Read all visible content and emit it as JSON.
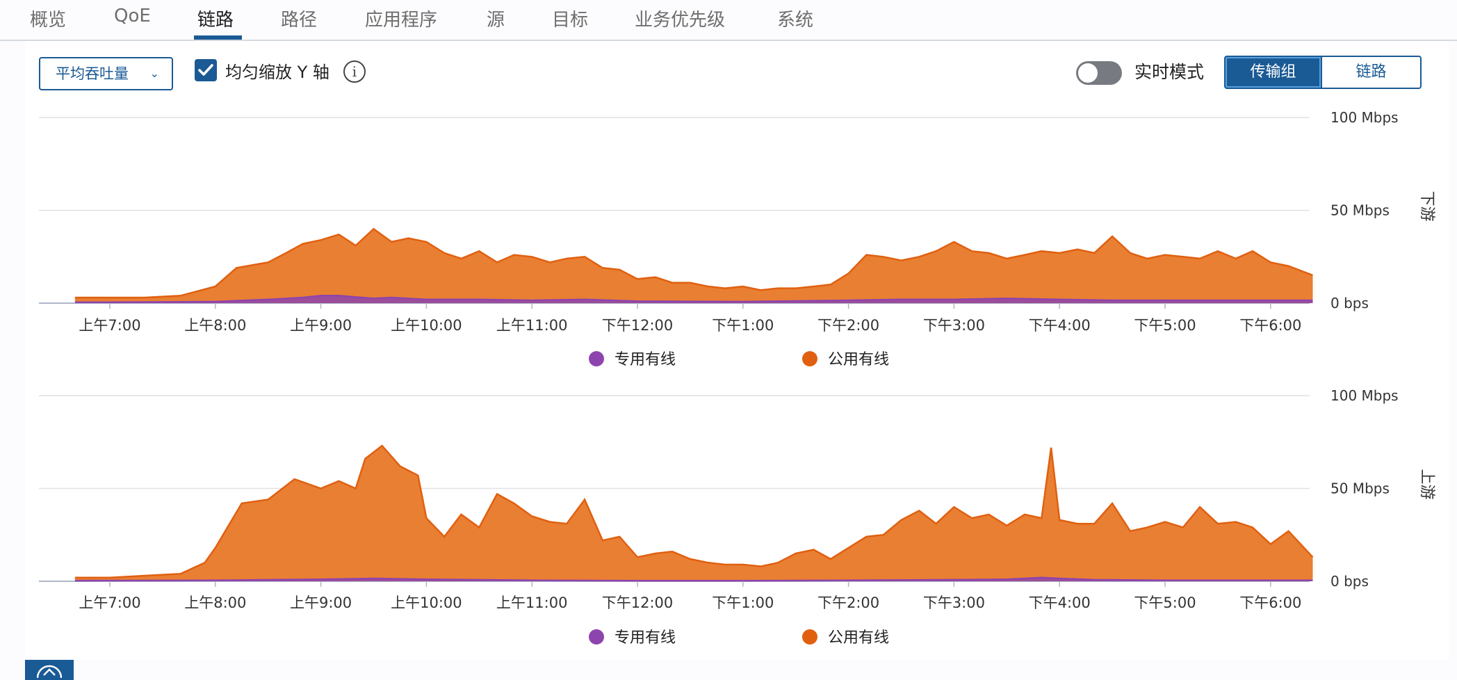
{
  "tabs": [
    {
      "label": "概览",
      "left": 43
    },
    {
      "label": "QoE",
      "left": 164
    },
    {
      "label": "链路",
      "left": 284,
      "active": true
    },
    {
      "label": "路径",
      "left": 404
    },
    {
      "label": "应用程序",
      "left": 525
    },
    {
      "label": "源",
      "left": 700
    },
    {
      "label": "目标",
      "left": 794
    },
    {
      "label": "业务优先级",
      "left": 913
    },
    {
      "label": "系统",
      "left": 1118
    }
  ],
  "toolbar": {
    "metric_dropdown": "平均吞吐量",
    "scale_y_checkbox_label": "均匀缩放 Y 轴",
    "scale_y_checked": true,
    "info_icon": "info-icon",
    "realtime_label": "实时模式",
    "realtime_on": false,
    "group_transport": "传输组",
    "group_link": "链路"
  },
  "colors": {
    "private": "#8e44ad",
    "public": "#e06010",
    "public_fill": "#e97f33",
    "accent": "#1a5a95"
  },
  "chart_data": [
    {
      "type": "area",
      "side_label": "下游",
      "ylim": [
        0,
        100
      ],
      "y_ticks": [
        "0 bps",
        "50 Mbps",
        "100 Mbps"
      ],
      "x_tick_labels": [
        "上午7:00",
        "上午8:00",
        "上午9:00",
        "上午10:00",
        "上午11:00",
        "下午12:00",
        "下午1:00",
        "下午2:00",
        "下午3:00",
        "下午4:00",
        "下午5:00",
        "下午6:00"
      ],
      "series": [
        {
          "name": "专用有线",
          "color": "#8e44ad",
          "points": [
            [
              6.67,
              0.5
            ],
            [
              7.0,
              0.5
            ],
            [
              7.5,
              0.6
            ],
            [
              8.0,
              0.8
            ],
            [
              8.5,
              2.0
            ],
            [
              8.83,
              3.0
            ],
            [
              9.0,
              4.0
            ],
            [
              9.17,
              4.0
            ],
            [
              9.5,
              2.5
            ],
            [
              9.67,
              3.0
            ],
            [
              10.0,
              2.0
            ],
            [
              10.5,
              2.0
            ],
            [
              11.0,
              1.5
            ],
            [
              11.5,
              2.0
            ],
            [
              12.0,
              1.0
            ],
            [
              13.0,
              0.8
            ],
            [
              14.0,
              1.5
            ],
            [
              14.5,
              2.0
            ],
            [
              15.0,
              2.0
            ],
            [
              15.5,
              2.5
            ],
            [
              16.0,
              2.0
            ],
            [
              16.5,
              1.5
            ],
            [
              17.0,
              1.5
            ],
            [
              17.5,
              1.5
            ],
            [
              18.0,
              1.5
            ],
            [
              18.4,
              1.5
            ]
          ]
        },
        {
          "name": "公用有线",
          "color": "#e06010",
          "points": [
            [
              6.67,
              3
            ],
            [
              7.0,
              3
            ],
            [
              7.33,
              3
            ],
            [
              7.67,
              4
            ],
            [
              8.0,
              9
            ],
            [
              8.2,
              19
            ],
            [
              8.5,
              22
            ],
            [
              8.67,
              27
            ],
            [
              8.83,
              32
            ],
            [
              9.0,
              34
            ],
            [
              9.17,
              37
            ],
            [
              9.33,
              31
            ],
            [
              9.5,
              40
            ],
            [
              9.67,
              33
            ],
            [
              9.83,
              35
            ],
            [
              10.0,
              33
            ],
            [
              10.17,
              27
            ],
            [
              10.33,
              24
            ],
            [
              10.5,
              28
            ],
            [
              10.67,
              22
            ],
            [
              10.83,
              26
            ],
            [
              11.0,
              25
            ],
            [
              11.17,
              22
            ],
            [
              11.33,
              24
            ],
            [
              11.5,
              25
            ],
            [
              11.67,
              19
            ],
            [
              11.83,
              18
            ],
            [
              12.0,
              13
            ],
            [
              12.17,
              14
            ],
            [
              12.33,
              11
            ],
            [
              12.5,
              11
            ],
            [
              12.67,
              9
            ],
            [
              12.83,
              8
            ],
            [
              13.0,
              9
            ],
            [
              13.17,
              7
            ],
            [
              13.33,
              8
            ],
            [
              13.5,
              8
            ],
            [
              13.67,
              9
            ],
            [
              13.83,
              10
            ],
            [
              14.0,
              16
            ],
            [
              14.17,
              26
            ],
            [
              14.33,
              25
            ],
            [
              14.5,
              23
            ],
            [
              14.67,
              25
            ],
            [
              14.83,
              28
            ],
            [
              15.0,
              33
            ],
            [
              15.17,
              28
            ],
            [
              15.33,
              27
            ],
            [
              15.5,
              24
            ],
            [
              15.67,
              26
            ],
            [
              15.83,
              28
            ],
            [
              16.0,
              27
            ],
            [
              16.17,
              29
            ],
            [
              16.33,
              27
            ],
            [
              16.5,
              36
            ],
            [
              16.67,
              27
            ],
            [
              16.83,
              24
            ],
            [
              17.0,
              26
            ],
            [
              17.17,
              25
            ],
            [
              17.33,
              24
            ],
            [
              17.5,
              28
            ],
            [
              17.67,
              24
            ],
            [
              17.83,
              28
            ],
            [
              18.0,
              22
            ],
            [
              18.17,
              20
            ],
            [
              18.4,
              15
            ]
          ]
        }
      ]
    },
    {
      "type": "area",
      "side_label": "上游",
      "ylim": [
        0,
        100
      ],
      "y_ticks": [
        "0 bps",
        "50 Mbps",
        "100 Mbps"
      ],
      "x_tick_labels": [
        "上午7:00",
        "上午8:00",
        "上午9:00",
        "上午10:00",
        "上午11:00",
        "下午12:00",
        "下午1:00",
        "下午2:00",
        "下午3:00",
        "下午4:00",
        "下午5:00",
        "下午6:00"
      ],
      "series": [
        {
          "name": "专用有线",
          "color": "#8e44ad",
          "points": [
            [
              6.67,
              0.3
            ],
            [
              8.0,
              0.5
            ],
            [
              9.0,
              1.0
            ],
            [
              9.5,
              1.5
            ],
            [
              10.0,
              1.0
            ],
            [
              11.0,
              0.5
            ],
            [
              12.0,
              0.3
            ],
            [
              13.0,
              0.3
            ],
            [
              14.0,
              0.5
            ],
            [
              15.0,
              0.8
            ],
            [
              15.5,
              1.0
            ],
            [
              15.83,
              2.0
            ],
            [
              16.0,
              1.5
            ],
            [
              16.33,
              0.8
            ],
            [
              17.0,
              0.5
            ],
            [
              18.0,
              0.5
            ],
            [
              18.4,
              0.5
            ]
          ]
        },
        {
          "name": "公用有线",
          "color": "#e06010",
          "points": [
            [
              6.67,
              2
            ],
            [
              7.0,
              2
            ],
            [
              7.33,
              3
            ],
            [
              7.67,
              4
            ],
            [
              7.9,
              10
            ],
            [
              8.0,
              18
            ],
            [
              8.25,
              42
            ],
            [
              8.5,
              44
            ],
            [
              8.75,
              55
            ],
            [
              9.0,
              50
            ],
            [
              9.17,
              54
            ],
            [
              9.33,
              50
            ],
            [
              9.42,
              66
            ],
            [
              9.58,
              73
            ],
            [
              9.75,
              62
            ],
            [
              9.92,
              57
            ],
            [
              10.0,
              34
            ],
            [
              10.17,
              24
            ],
            [
              10.33,
              36
            ],
            [
              10.5,
              29
            ],
            [
              10.67,
              47
            ],
            [
              10.83,
              42
            ],
            [
              11.0,
              35
            ],
            [
              11.17,
              32
            ],
            [
              11.33,
              31
            ],
            [
              11.5,
              44
            ],
            [
              11.67,
              22
            ],
            [
              11.83,
              24
            ],
            [
              12.0,
              13
            ],
            [
              12.17,
              15
            ],
            [
              12.33,
              16
            ],
            [
              12.5,
              12
            ],
            [
              12.67,
              10
            ],
            [
              12.83,
              9
            ],
            [
              13.0,
              9
            ],
            [
              13.17,
              8
            ],
            [
              13.33,
              10
            ],
            [
              13.5,
              15
            ],
            [
              13.67,
              17
            ],
            [
              13.83,
              12
            ],
            [
              14.0,
              18
            ],
            [
              14.17,
              24
            ],
            [
              14.33,
              25
            ],
            [
              14.5,
              33
            ],
            [
              14.67,
              38
            ],
            [
              14.83,
              31
            ],
            [
              15.0,
              40
            ],
            [
              15.17,
              34
            ],
            [
              15.33,
              36
            ],
            [
              15.5,
              30
            ],
            [
              15.67,
              36
            ],
            [
              15.83,
              34
            ],
            [
              15.92,
              72
            ],
            [
              16.0,
              33
            ],
            [
              16.17,
              31
            ],
            [
              16.33,
              31
            ],
            [
              16.5,
              42
            ],
            [
              16.67,
              27
            ],
            [
              16.83,
              29
            ],
            [
              17.0,
              32
            ],
            [
              17.17,
              29
            ],
            [
              17.33,
              40
            ],
            [
              17.5,
              31
            ],
            [
              17.67,
              32
            ],
            [
              17.83,
              29
            ],
            [
              18.0,
              20
            ],
            [
              18.17,
              27
            ],
            [
              18.4,
              13
            ]
          ]
        }
      ]
    }
  ],
  "legend": {
    "private": "专用有线",
    "public": "公用有线"
  }
}
